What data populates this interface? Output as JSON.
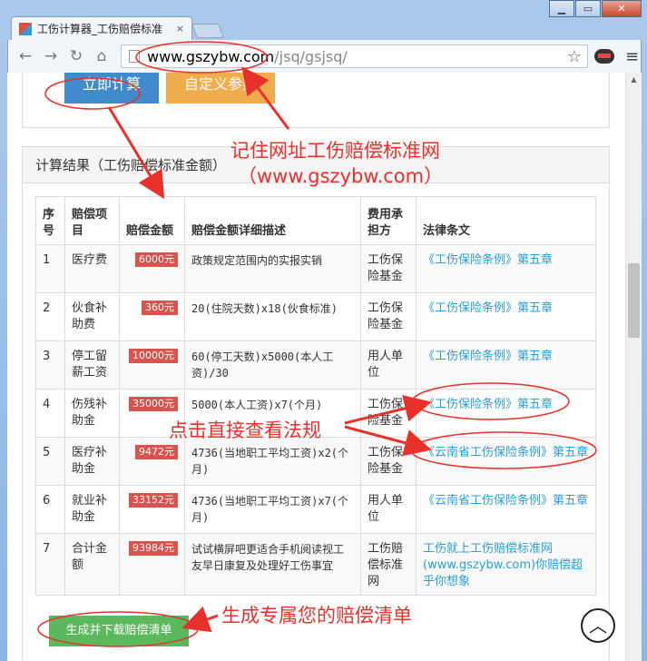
{
  "browser": {
    "tab_title": "工伤计算器_工伤赔偿标准",
    "tab_close": "×",
    "url_host": "www.gszybw.com",
    "url_path": "/jsq/gsjsq/",
    "window_buttons": [
      "▁",
      "▭",
      "✕"
    ],
    "nav_icons": [
      "back-icon",
      "forward-icon",
      "reload-icon",
      "home-icon"
    ]
  },
  "form": {
    "calc_label": "立即计算",
    "custom_label": "自定义参数"
  },
  "results": {
    "heading": "计算结果（工伤赔偿标准金额）",
    "columns": [
      "序号",
      "赔偿项目",
      "赔偿金额",
      "赔偿金额详细描述",
      "费用承担方",
      "法律条文"
    ],
    "rows": [
      {
        "no": "1",
        "item": "医疗费",
        "amount": "6000元",
        "desc": "政策规定范围内的实报实销",
        "payer": "工伤保险基金",
        "law": "《工伤保险条例》第五章"
      },
      {
        "no": "2",
        "item": "伙食补助费",
        "amount": "360元",
        "desc": "20(住院天数)x18(伙食标准)",
        "payer": "工伤保险基金",
        "law": "《工伤保险条例》第五章"
      },
      {
        "no": "3",
        "item": "停工留薪工资",
        "amount": "10000元",
        "desc": "60(停工天数)x5000(本人工资)/30",
        "payer": "用人单位",
        "law": "《工伤保险条例》第五章"
      },
      {
        "no": "4",
        "item": "伤残补助金",
        "amount": "35000元",
        "desc": "5000(本人工资)x7(个月)",
        "payer": "工伤保险基金",
        "law": "《工伤保险条例》第五章"
      },
      {
        "no": "5",
        "item": "医疗补助金",
        "amount": "9472元",
        "desc": "4736(当地职工平均工资)x2(个月)",
        "payer": "工伤保险基金",
        "law": "《云南省工伤保险条例》第五章"
      },
      {
        "no": "6",
        "item": "就业补助金",
        "amount": "33152元",
        "desc": "4736(当地职工平均工资)x7(个月)",
        "payer": "用人单位",
        "law": "《云南省工伤保险条例》第五章"
      },
      {
        "no": "7",
        "item": "合计金额",
        "amount": "93984元",
        "desc": "试试横屏吧更适合手机阅读视工友早日康复及处理好工伤事宜",
        "payer": "工伤赔偿标准网",
        "law": "工伤就上工伤赔偿标准网(www.gszybw.com)你赔偿超乎你想象"
      }
    ],
    "generate_label": "生成并下载赔偿清单",
    "to_top": "︿"
  },
  "annotations": {
    "remember_line1": "记住网址工伤赔偿标准网",
    "remember_line2": "（www.gszybw.com）",
    "click_law": "点击直接查看法规",
    "generate_note": "生成专属您的赔偿清单"
  },
  "colors": {
    "annotation": "#e8312a",
    "calc_button": "#428bca",
    "custom_button": "#f0ad4e",
    "amount_badge": "#d9534f",
    "law_link": "#2a9fd6",
    "generate_button": "#5cb85c"
  }
}
